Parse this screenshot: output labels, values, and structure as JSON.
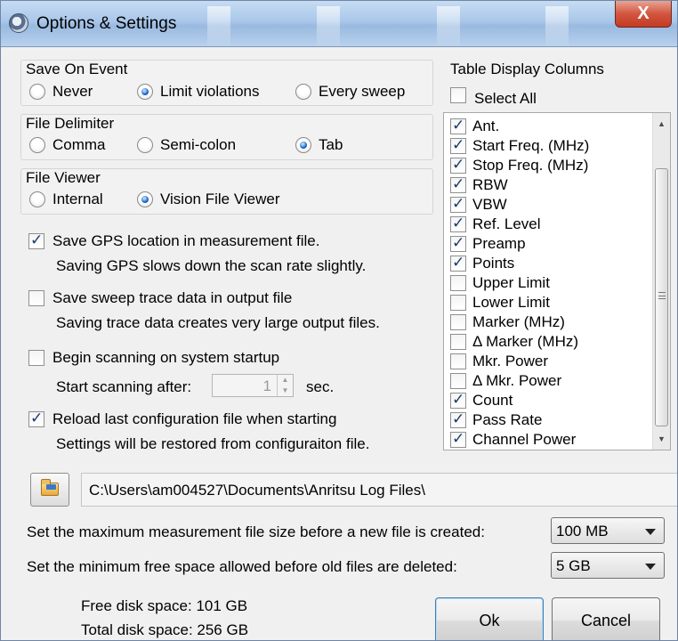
{
  "window": {
    "title": "Options & Settings",
    "close_label": "X"
  },
  "save_on_event": {
    "label": "Save On Event",
    "options": [
      {
        "label": "Never",
        "checked": false
      },
      {
        "label": "Limit violations",
        "checked": true
      },
      {
        "label": "Every sweep",
        "checked": false
      }
    ]
  },
  "file_delimiter": {
    "label": "File Delimiter",
    "options": [
      {
        "label": "Comma",
        "checked": false
      },
      {
        "label": "Semi-colon",
        "checked": false
      },
      {
        "label": "Tab",
        "checked": true
      }
    ]
  },
  "file_viewer": {
    "label": "File Viewer",
    "options": [
      {
        "label": "Internal",
        "checked": false
      },
      {
        "label": "Vision File Viewer",
        "checked": true
      }
    ]
  },
  "options": {
    "save_gps": {
      "label": "Save GPS location in measurement file.",
      "hint": "Saving GPS slows down the scan rate slightly.",
      "checked": true
    },
    "save_trace": {
      "label": "Save sweep trace data in output file",
      "hint": "Saving trace data creates very large output files.",
      "checked": false
    },
    "begin_scanning": {
      "label": "Begin scanning on system startup",
      "checked": false
    },
    "start_after": {
      "label": "Start scanning after:",
      "value": "1",
      "unit": "sec."
    },
    "reload_config": {
      "label": "Reload last configuration file when starting",
      "hint": "Settings will be restored from configuraiton file.",
      "checked": true
    }
  },
  "table_columns": {
    "label": "Table Display Columns",
    "select_all": {
      "label": "Select All",
      "checked": false
    },
    "items": [
      {
        "label": "Ant.",
        "checked": true
      },
      {
        "label": "Start Freq. (MHz)",
        "checked": true
      },
      {
        "label": "Stop Freq. (MHz)",
        "checked": true
      },
      {
        "label": "RBW",
        "checked": true
      },
      {
        "label": "VBW",
        "checked": true
      },
      {
        "label": "Ref. Level",
        "checked": true
      },
      {
        "label": "Preamp",
        "checked": true
      },
      {
        "label": "Points",
        "checked": true
      },
      {
        "label": "Upper Limit",
        "checked": false
      },
      {
        "label": "Lower Limit",
        "checked": false
      },
      {
        "label": "Marker (MHz)",
        "checked": false
      },
      {
        "label": "Δ Marker (MHz)",
        "checked": false
      },
      {
        "label": "Mkr. Power",
        "checked": false
      },
      {
        "label": "Δ Mkr.  Power",
        "checked": false
      },
      {
        "label": "Count",
        "checked": true
      },
      {
        "label": "Pass Rate",
        "checked": true
      },
      {
        "label": "Channel Power",
        "checked": true
      }
    ]
  },
  "log_path": {
    "value": "C:\\Users\\am004527\\Documents\\Anritsu Log Files\\"
  },
  "max_file_size": {
    "label": "Set the maximum measurement file size before a new file is created:",
    "value": "100 MB"
  },
  "min_free_space": {
    "label": "Set the minimum free space allowed before old files are deleted:",
    "value": "5 GB"
  },
  "disk": {
    "free": "Free disk space: 101 GB",
    "total": "Total disk space: 256 GB"
  },
  "buttons": {
    "ok": "Ok",
    "cancel": "Cancel"
  }
}
